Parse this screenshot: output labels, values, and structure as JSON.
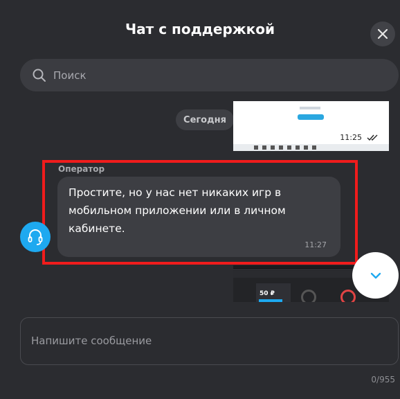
{
  "header": {
    "title": "Чат с поддержкой"
  },
  "search": {
    "placeholder": "Поиск"
  },
  "feed": {
    "date_label": "Сегодня"
  },
  "attachment_top": {
    "time": "11:25"
  },
  "operator_message": {
    "sender": "Оператор",
    "text": "Простите, но у нас нет никаких игр в мобильном приложении или в личном кабинете.",
    "time": "11:27"
  },
  "attachment_bottom": {
    "amount": "50 ₽"
  },
  "composer": {
    "placeholder": "Напишите сообщение",
    "counter": "0/955"
  },
  "colors": {
    "accent": "#1ea9f0",
    "highlight": "#f01c1c",
    "background": "#2b2c30"
  }
}
